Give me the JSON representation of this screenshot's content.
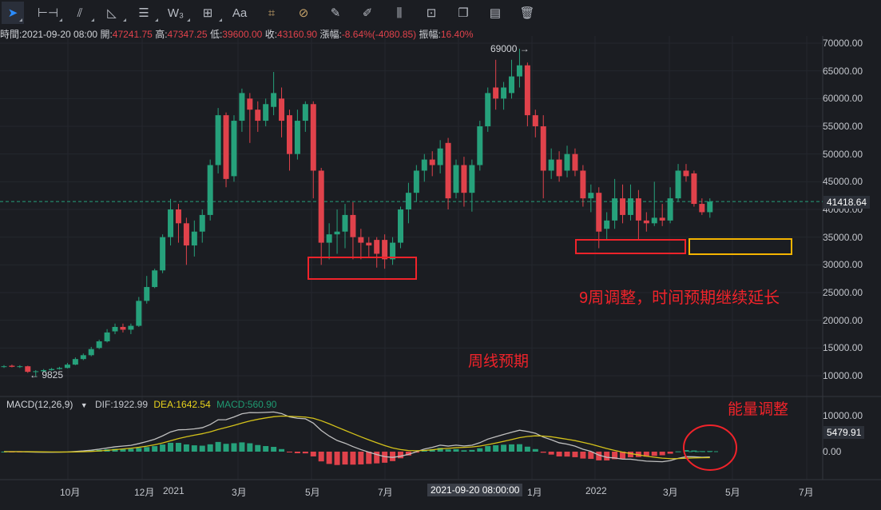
{
  "toolbar": {
    "items": [
      {
        "name": "cursor-tool",
        "glyph": "➤"
      },
      {
        "name": "horizontal-line-tool",
        "glyph": "⊢⊣"
      },
      {
        "name": "trend-line-tool",
        "glyph": "⫽"
      },
      {
        "name": "triangle-tool",
        "glyph": "◺"
      },
      {
        "name": "parallel-channel-tool",
        "glyph": "☰"
      },
      {
        "name": "wave-tool",
        "glyph": "W₃"
      },
      {
        "name": "rectangle-tool",
        "glyph": "⊞"
      },
      {
        "name": "text-tool",
        "glyph": "Aa"
      },
      {
        "name": "ruler-tool",
        "glyph": "⌗"
      },
      {
        "name": "magnet-tool",
        "glyph": "⊘"
      },
      {
        "name": "measure-tool",
        "glyph": "✎"
      },
      {
        "name": "brush-tool",
        "glyph": "✐"
      },
      {
        "name": "candles-tool",
        "glyph": "⫼"
      },
      {
        "name": "lock-tool",
        "glyph": "⊡"
      },
      {
        "name": "copy-tool",
        "glyph": "❐"
      },
      {
        "name": "note-tool",
        "glyph": "▤"
      },
      {
        "name": "delete-tool",
        "glyph": "🗑"
      }
    ]
  },
  "info": {
    "time_label": "時間:",
    "time": "2021-09-20 08:00",
    "open_label": "開:",
    "open": "47241.75",
    "high_label": "高:",
    "high": "47347.25",
    "low_label": "低:",
    "low": "39600.00",
    "close_label": "收:",
    "close": "43160.90",
    "change_label": "漲幅:",
    "change": "-8.64%(-4080.85)",
    "amp_label": "振幅:",
    "amp": "16.40%"
  },
  "macd": {
    "label": "MACD(12,26,9)",
    "dif": "DIF:1922.99",
    "dea": "DEA:1642.54",
    "macd": "MACD:560.90",
    "axis": [
      "10000.00",
      "0.00"
    ],
    "current": "5479.91"
  },
  "price_axis": [
    "70000.00",
    "65000.00",
    "60000.00",
    "55000.00",
    "50000.00",
    "45000.00",
    "40000.00",
    "35000.00",
    "30000.00",
    "25000.00",
    "20000.00",
    "15000.00",
    "10000.00"
  ],
  "current_price": "41418.64",
  "x_axis": [
    "10月",
    "12月",
    "2021",
    "3月",
    "5月",
    "7月",
    "2021-09-20 08:00:00",
    "1月",
    "2022",
    "3月",
    "5月",
    "7月"
  ],
  "annotations": {
    "high": "69000 →",
    "low": "← 9825",
    "note1": "9周调整，时间预期继续延长",
    "note2": "周线预期",
    "note3": "能量调整"
  },
  "colors": {
    "up": "#26a17b",
    "down": "#e0424b",
    "accent": "#2b8cff",
    "dif": "#c0c0c0",
    "dea": "#d4c21a",
    "box_red": "#f0232a",
    "box_yellow": "#f5b400"
  },
  "chart_data": {
    "type": "candlestick",
    "interval": "weekly",
    "ylim": [
      10000,
      70000
    ],
    "ohlc": [
      [
        11600,
        11700,
        11900,
        11400
      ],
      [
        11800,
        11600,
        12000,
        11500
      ],
      [
        11600,
        11700,
        11900,
        11400
      ],
      [
        11700,
        10700,
        11800,
        10500
      ],
      [
        10700,
        10800,
        11000,
        9825
      ],
      [
        10800,
        11000,
        11200,
        10700
      ],
      [
        11000,
        11200,
        11400,
        10900
      ],
      [
        11200,
        11400,
        11600,
        11100
      ],
      [
        11400,
        12000,
        12300,
        11300
      ],
      [
        12000,
        13000,
        13300,
        11900
      ],
      [
        13000,
        13700,
        14000,
        12800
      ],
      [
        13700,
        14800,
        15200,
        13500
      ],
      [
        15000,
        16200,
        16500,
        14800
      ],
      [
        16200,
        17800,
        18400,
        16000
      ],
      [
        18000,
        18800,
        19400,
        17500
      ],
      [
        18800,
        18300,
        19400,
        17800
      ],
      [
        18300,
        19000,
        19400,
        17500
      ],
      [
        19000,
        23500,
        24200,
        18800
      ],
      [
        23500,
        26000,
        28000,
        23000
      ],
      [
        26000,
        29000,
        29300,
        25800
      ],
      [
        29000,
        35000,
        35500,
        28500
      ],
      [
        35000,
        40000,
        41900,
        33500
      ],
      [
        40000,
        37500,
        41000,
        34000
      ],
      [
        37500,
        33500,
        38500,
        30000
      ],
      [
        33500,
        36000,
        38000,
        31500
      ],
      [
        36000,
        39000,
        40000,
        34000
      ],
      [
        39000,
        48000,
        49000,
        38000
      ],
      [
        48000,
        57000,
        58300,
        46500
      ],
      [
        57000,
        45500,
        57500,
        44000
      ],
      [
        46000,
        56000,
        57000,
        45000
      ],
      [
        56000,
        61000,
        61800,
        54000
      ],
      [
        60000,
        58000,
        61000,
        52000
      ],
      [
        58000,
        56000,
        59500,
        54000
      ],
      [
        56000,
        59000,
        60000,
        55000
      ],
      [
        58500,
        61000,
        64800,
        57000
      ],
      [
        60000,
        56000,
        62000,
        53000
      ],
      [
        57000,
        50000,
        58000,
        47000
      ],
      [
        50000,
        56000,
        58000,
        49000
      ],
      [
        56000,
        59000,
        59500,
        54000
      ],
      [
        59000,
        47000,
        59500,
        42000
      ],
      [
        47000,
        34000,
        47500,
        30000
      ],
      [
        34000,
        35500,
        37500,
        31000
      ],
      [
        35500,
        36000,
        40000,
        32000
      ],
      [
        36000,
        39000,
        41000,
        33000
      ],
      [
        39000,
        35000,
        41300,
        31000
      ],
      [
        35000,
        34000,
        36500,
        31000
      ],
      [
        34000,
        33500,
        35000,
        31500
      ],
      [
        34500,
        32000,
        35000,
        29500
      ],
      [
        34500,
        31000,
        35500,
        29300
      ],
      [
        31000,
        34000,
        35000,
        30000
      ],
      [
        34000,
        40000,
        40500,
        33000
      ],
      [
        40000,
        43000,
        44800,
        37500
      ],
      [
        43000,
        47000,
        48000,
        41500
      ],
      [
        47000,
        49000,
        50000,
        45000
      ],
      [
        49000,
        48000,
        50500,
        46000
      ],
      [
        48000,
        51000,
        52500,
        46500
      ],
      [
        52000,
        42000,
        52900,
        40000
      ],
      [
        43000,
        48000,
        49000,
        42000
      ],
      [
        48000,
        43000,
        49500,
        40500
      ],
      [
        43000,
        48000,
        49000,
        39600
      ],
      [
        48000,
        55000,
        56000,
        47000
      ],
      [
        55000,
        61000,
        62000,
        54000
      ],
      [
        62000,
        60000,
        67000,
        58000
      ],
      [
        60000,
        62000,
        63000,
        58000
      ],
      [
        61000,
        64000,
        67000,
        60000
      ],
      [
        64000,
        66000,
        69000,
        62000
      ],
      [
        66000,
        57000,
        66500,
        55000
      ],
      [
        57000,
        55000,
        58000,
        53000
      ],
      [
        55000,
        47000,
        57000,
        42000
      ],
      [
        47000,
        49000,
        51000,
        45500
      ],
      [
        49000,
        46000,
        50500,
        45000
      ],
      [
        47000,
        50000,
        51500,
        45800
      ],
      [
        50000,
        47000,
        51000,
        46000
      ],
      [
        47000,
        42000,
        48000,
        40500
      ],
      [
        42000,
        43000,
        44500,
        39500
      ],
      [
        43000,
        36000,
        44000,
        33000
      ],
      [
        36500,
        38000,
        39500,
        34500
      ],
      [
        38000,
        42000,
        45500,
        36500
      ],
      [
        42000,
        39000,
        44500,
        37500
      ],
      [
        39000,
        42000,
        44500,
        38000
      ],
      [
        42000,
        38000,
        43500,
        34500
      ],
      [
        38000,
        37500,
        39500,
        36000
      ],
      [
        37500,
        38500,
        45000,
        37000
      ],
      [
        38500,
        38000,
        41000,
        37000
      ],
      [
        38000,
        42000,
        44000,
        37500
      ],
      [
        42000,
        47000,
        48200,
        41500
      ],
      [
        47000,
        46000,
        48200,
        45000
      ],
      [
        46500,
        41000,
        47000,
        40500
      ],
      [
        41000,
        39500,
        42000,
        39000
      ],
      [
        39500,
        41418.64,
        42000,
        38500
      ]
    ]
  }
}
